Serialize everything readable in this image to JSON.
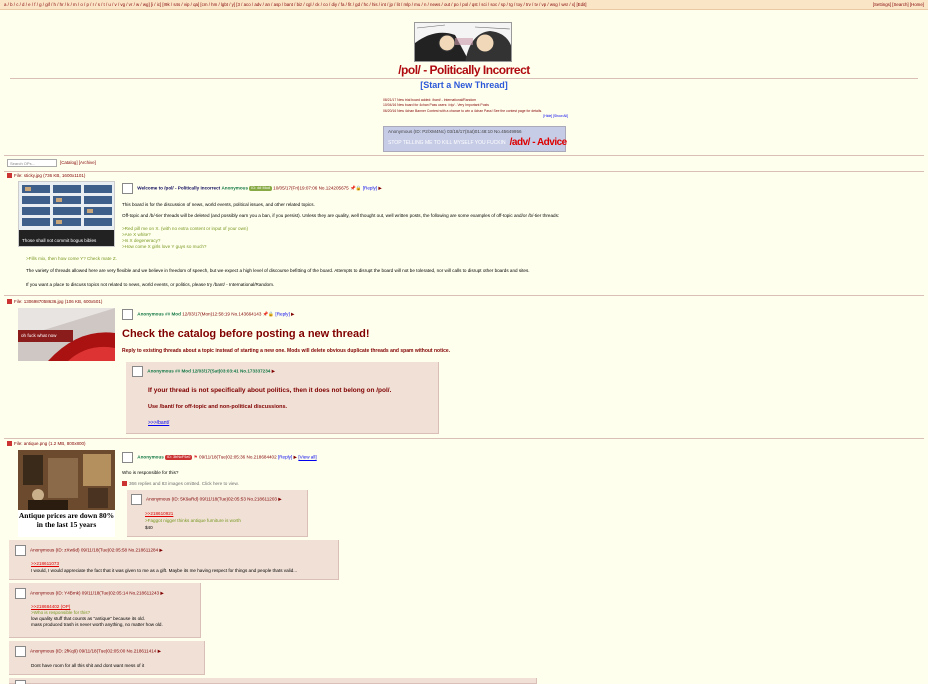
{
  "topbar": {
    "boards": "a / b / c / d / e / f / g / gif / h / hr / k / m / o / p / r / s / t / u / v / vg / vr / w / wg] [i / ic] [r9k / s4s / vip / qa] [cm / hm / lgbt / y] [3 / aco / adv / an / asp / bant / biz / cgl / ck / co / diy / fa / fit / gd / hc / his / int / jp / lit / mlp / mu / n / news / out / po / pol / qst / sci / soc / sp / tg / toy / trv / tv / vp / wsg / wsr / x] [Edit]",
    "settings": "[Settings] [Search] [Home]"
  },
  "header": {
    "title": "/pol/ - Politically Incorrect",
    "start_thread": "[Start a New Thread]"
  },
  "announcements": [
    "08/21/17  New trial board added: /bant/ - International/Random",
    "10/04/16  New board for 4chan Pass users: /vip/ - Very Important Posts",
    "06/20/16  New 4chan Banner Contest with a chance to win a 4chan Pass! See the contest page for details.",
    "[Hide] [Show All]"
  ],
  "ad": {
    "top": "Anonymous (ID: P2/XM4Nc) 03/18/17(Sat)01:48:10 No.45649956",
    "bottom": "STOP TELLING ME TO KILL MYSELF YOU FUCKIN",
    "big": "/adv/ - Advice"
  },
  "search": {
    "placeholder": "Search OPs..."
  },
  "catalog_links": "[Catalog] [Archive]",
  "thread1": {
    "fileline": "File: sticky.jpg (736 KB, 1600x1101)",
    "thumb_caption": "Those shall not commit bogus bibles",
    "subject": "Welcome to /pol/ - Politically Incorrect",
    "name": "Anonymous",
    "id": "ID: ## Mod",
    "meta": "10/05/17(Fri)19:07:06 No.124205675",
    "reply": "[Reply]",
    "line1": "This board is for the discussion of news, world events, political issues, and other related topics.",
    "line2": "Off-topic and /b/-tier threads will be deleted (and possibly earn you a ban, if you persist). Unless they are quality, well thought out, well written posts, the following are some examples of off-topic and/or /b/-tier threads:",
    "greens": [
      ">Red pill me on X. (with no extra content or input of your own)",
      ">Are X white?",
      ">Is X degeneracy?",
      ">How come X girls love Y guys so much?"
    ],
    "green5": ">Fills mix, then how come Y? Check mate Z.",
    "line3": "The variety of threads allowed here are very flexible and we believe in freedom of speech, but we expect a high level of discourse befitting of the board. Attempts to disrupt the board will not be tolerated, nor will calls to disrupt other boards and sites.",
    "line4": "If you want a place to discuss topics not related to news, world events, or politics, please try /bant/ - International/Random."
  },
  "thread2": {
    "fileline": "File: 1306987058636.jpg (106 KB, 600x501)",
    "thumb_caption": "oh fuck what now",
    "name": "Anonymous ## Mod",
    "meta": "12/03/17(Mon)12:58:19 No.143664143",
    "reply": "[Reply]",
    "headline": "Check the catalog before posting a new thread!",
    "sub": "Reply to existing threads about a topic instead of starting a new one. Mods will delete obvious duplicate threads and spam without notice.",
    "reply_post": {
      "head": "Anonymous ## Mod 12/03/17(Sat)03:03:41 No.173337234",
      "line1": "If your thread is not specifically about politics, then it does not belong on /pol/.",
      "line2": "Use /bant/ for off-topic and non-political discussions.",
      "link": ">>>/bant/"
    }
  },
  "thread3": {
    "fileline": "File: antique.png (1.2 MB, 800x800)",
    "thumb_caption": "Antique prices are down 80% in the last 15 years",
    "name": "Anonymous",
    "id": "ID: 3bNcF9z0",
    "meta": "09/11/18(Tue)02:05:36 No.218684402",
    "reply": "[Reply]",
    "extra": "[View all]",
    "question": "Who is responsible for this?",
    "omitted": "366 replies and 83 images omitted. Click here to view.",
    "replies": [
      {
        "head": "Anonymous (ID: 5K9aRd) 09/11/18(Tue)02:05:53 No.218611203",
        "quote": ">>218610921",
        "text": ">Faggot nigger thinks antique furniture is worth",
        "tail": "$40"
      },
      {
        "head": "Anonymous (ID: zXw9d) 09/11/18(Tue)02:05:58 No.218611284",
        "quote": ">>218611073",
        "text": "I would, I would appreciate the fact that it was given to me as a gift. Maybe its me having respect for things and people thats valid..."
      },
      {
        "head": "Anonymous (ID: Y4Bmk) 09/11/18(Tue)02:05:14 No.218611243",
        "quote": ">>218684402 (OP)",
        "text": ">Who is responsible for this?",
        "text2": "low quality stuff that counts as \"antique\" because its old.",
        "text3": "mass produced trash is never worth anything, no matter how old."
      },
      {
        "head": "Anonymous (ID: 2fKq9) 09/11/18(Tue)02:05:00 No.218611414",
        "text": "Dont have room for all this shit and dont want mess of it"
      }
    ]
  },
  "colors": {
    "background": "#ffffee",
    "post_bg": "#f0e0d6",
    "title": "#af0a0f",
    "name": "#117743",
    "link": "#2c59d8"
  }
}
